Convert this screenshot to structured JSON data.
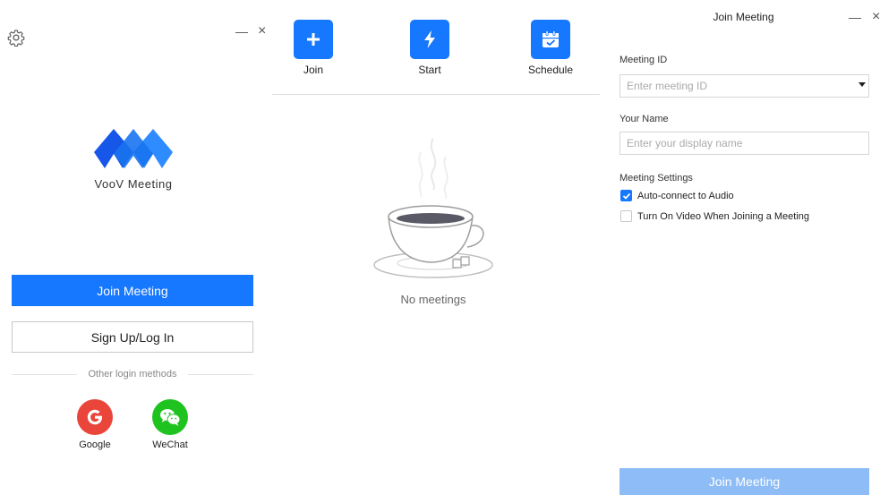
{
  "left": {
    "settings_icon": "gear-icon",
    "minimize_glyph": "—",
    "close_glyph": "×",
    "brand_name": "VooV Meeting",
    "join_label": "Join Meeting",
    "signup_label": "Sign Up/Log In",
    "other_methods_label": "Other login methods",
    "social": [
      {
        "label": "Google",
        "icon": "google-icon",
        "color": "#e9453a"
      },
      {
        "label": "WeChat",
        "icon": "wechat-icon",
        "color": "#1fc31f"
      }
    ]
  },
  "middle": {
    "actions": [
      {
        "label": "Join",
        "icon": "plus-icon"
      },
      {
        "label": "Start",
        "icon": "lightning-icon"
      },
      {
        "label": "Schedule",
        "icon": "calendar-icon"
      }
    ],
    "empty_text": "No meetings"
  },
  "right": {
    "title": "Join Meeting",
    "minimize_glyph": "—",
    "close_glyph": "×",
    "meeting_id_label": "Meeting ID",
    "meeting_id_placeholder": "Enter meeting ID",
    "meeting_id_value": "",
    "name_label": "Your Name",
    "name_placeholder": "Enter your display name",
    "name_value": "",
    "settings_label": "Meeting Settings",
    "options": [
      {
        "label": "Auto-connect to Audio",
        "checked": true
      },
      {
        "label": "Turn On Video When Joining a Meeting",
        "checked": false
      }
    ],
    "join_button_label": "Join Meeting"
  },
  "colors": {
    "accent": "#1677ff",
    "disabled_button": "#8dbcf6"
  }
}
